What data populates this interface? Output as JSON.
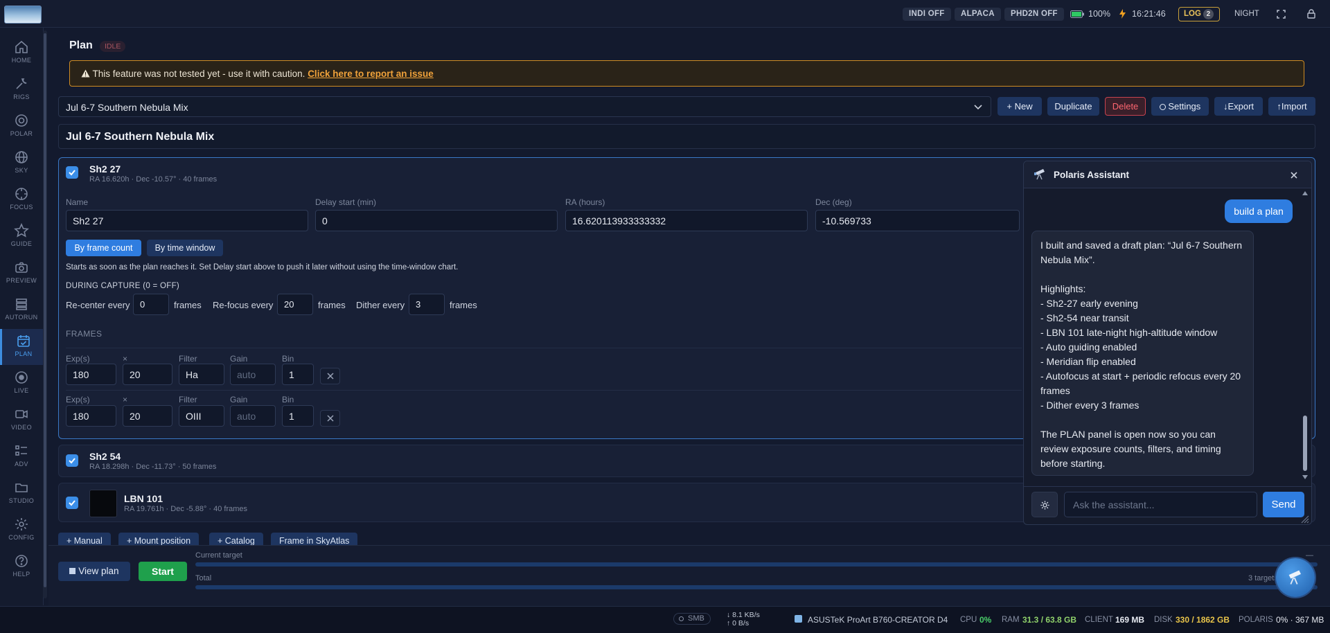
{
  "topbar": {
    "pills": [
      "INDI OFF",
      "ALPACA",
      "PHD2N OFF"
    ],
    "battery_percent": "100%",
    "time": "16:21:46",
    "log_label": "LOG",
    "log_count": "2",
    "night_label": "NIGHT"
  },
  "sidebar": {
    "items": [
      {
        "label": "HOME",
        "icon": "home-icon"
      },
      {
        "label": "RIGS",
        "icon": "wrench-icon"
      },
      {
        "label": "POLAR",
        "icon": "target-icon"
      },
      {
        "label": "SKY",
        "icon": "globe-icon"
      },
      {
        "label": "FOCUS",
        "icon": "focus-icon"
      },
      {
        "label": "GUIDE",
        "icon": "star-icon"
      },
      {
        "label": "PREVIEW",
        "icon": "camera-icon"
      },
      {
        "label": "AUTORUN",
        "icon": "stack-icon"
      },
      {
        "label": "PLAN",
        "icon": "calendar-check-icon",
        "active": true
      },
      {
        "label": "LIVE",
        "icon": "record-icon"
      },
      {
        "label": "VIDEO",
        "icon": "video-icon"
      },
      {
        "label": "ADV",
        "icon": "list-icon"
      },
      {
        "label": "STUDIO",
        "icon": "folder-icon"
      },
      {
        "label": "CONFIG",
        "icon": "gear-icon"
      },
      {
        "label": "HELP",
        "icon": "help-icon"
      }
    ]
  },
  "plan": {
    "title": "Plan",
    "status": "IDLE",
    "warning_text": "This feature was not tested yet - use it with caution.",
    "warning_link": "Click here to report an issue",
    "selected_plan": "Jul 6-7 Southern Nebula Mix",
    "plan_name": "Jul 6-7 Southern Nebula Mix",
    "buttons": {
      "new": "+ New",
      "duplicate": "Duplicate",
      "delete": "Delete",
      "settings": "Settings",
      "export": "↓Export",
      "import": "↑Import"
    }
  },
  "target1": {
    "name": "Sh2 27",
    "sub": "RA 16.620h · Dec -10.57° · 40 frames",
    "fields": {
      "name_label": "Name",
      "name_value": "Sh2 27",
      "delay_label": "Delay start (min)",
      "delay_value": "0",
      "ra_label": "RA (hours)",
      "ra_value": "16.620113933333332",
      "dec_label": "Dec (deg)",
      "dec_value": "-10.569733"
    },
    "mode_frame": "By frame count",
    "mode_time": "By time window",
    "hint": "Starts as soon as the plan reaches it. Set Delay start above to push it later without using the time-window chart.",
    "during_capture": "DURING CAPTURE (0 = OFF)",
    "recenter_label": "Re-center every",
    "recenter_value": "0",
    "refocus_label": "Re-focus every",
    "refocus_value": "20",
    "dither_label": "Dither every",
    "dither_value": "3",
    "frames_unit": "frames",
    "frames_heading": "FRAMES",
    "col_exp": "Exp(s)",
    "col_x": "×",
    "col_filter": "Filter",
    "col_gain": "Gain",
    "col_bin": "Bin",
    "frames": [
      {
        "exp": "180",
        "count": "20",
        "filter": "Ha",
        "gain": "auto",
        "bin": "1"
      },
      {
        "exp": "180",
        "count": "20",
        "filter": "OIII",
        "gain": "auto",
        "bin": "1"
      }
    ]
  },
  "target2": {
    "name": "Sh2 54",
    "sub": "RA 18.298h · Dec -11.73° · 50 frames"
  },
  "target3": {
    "name": "LBN 101",
    "sub": "RA 19.761h · Dec -5.88° · 40 frames"
  },
  "add_buttons": [
    "+ Manual",
    "+ Mount position",
    "+ Catalog",
    "Frame in SkyAtlas"
  ],
  "run": {
    "view_plan": "View plan",
    "start": "Start",
    "current_target": "Current target",
    "total": "Total",
    "targets_count": "3 targets",
    "dash": "—"
  },
  "assistant": {
    "title": "Polaris Assistant",
    "user_message": "build a plan",
    "bot_lines": [
      "I built and saved a draft plan: “Jul 6-7 Southern Nebula Mix”.",
      "",
      "Highlights:",
      "- Sh2-27 early evening",
      "- Sh2-54 near transit",
      "- LBN 101 late-night high-altitude window",
      "- Auto guiding enabled",
      "- Meridian flip enabled",
      "- Autofocus at start + periodic refocus every 20 frames",
      "- Dither every 3 frames",
      "",
      "The PLAN panel is open now so you can review exposure counts, filters, and timing before starting."
    ],
    "input_placeholder": "Ask the assistant...",
    "send": "Send"
  },
  "statusbar": {
    "smb": "SMB",
    "down": "↓ 8.1 KB/s",
    "up": "↑ 0 B/s",
    "host": "ASUSTeK ProArt B760-CREATOR D4",
    "cpu_label": "CPU",
    "cpu_value": "0%",
    "ram_label": "RAM",
    "ram_value": "31.3 / 63.8 GB",
    "client_label": "CLIENT",
    "client_value": "169 MB",
    "disk_label": "DISK",
    "disk_value": "330 / 1862 GB",
    "polaris_label": "POLARIS",
    "polaris_value": "0% · 367 MB"
  },
  "colors": {
    "accent": "#3b8ee8",
    "warning": "#d08c22",
    "danger": "#c8434f",
    "success": "#1fa04c"
  }
}
